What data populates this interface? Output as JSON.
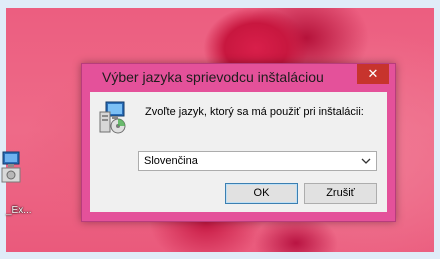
{
  "desktop": {
    "icon_name": "installer-shortcut-icon",
    "icon_label": "_Ex..."
  },
  "dialog": {
    "title": "Výber jazyka sprievodcu inštaláciou",
    "close_symbol": "✕",
    "setup_icon_name": "setup-installer-icon",
    "prompt": "Zvoľte jazyk, ktorý sa má použiť pri inštalácii:",
    "language_select": {
      "selected_value": "Slovenčina"
    },
    "ok_label": "OK",
    "cancel_label": "Zrušiť"
  },
  "colors": {
    "title_bar": "#e4519a",
    "close_button": "#c7342d",
    "client_area": "#f0f0f0"
  }
}
